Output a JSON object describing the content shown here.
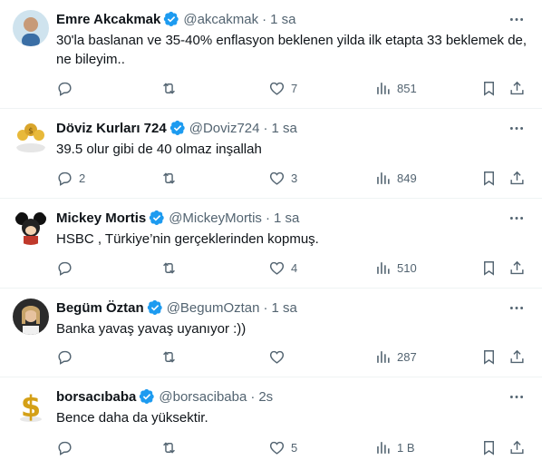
{
  "tweets": [
    {
      "name": "Emre Akcakmak",
      "handle": "@akcakmak",
      "dot": "·",
      "time": "1 sa",
      "text": "30'la baslanan ve 35-40% enflasyon beklenen yilda ilk etapta 33 beklemek de, ne bileyim..",
      "replies": "",
      "retweets": "",
      "likes": "7",
      "views": "851",
      "avatar_icon": "person-photo"
    },
    {
      "name": "Döviz Kurları 724",
      "handle": "@Doviz724",
      "dot": "·",
      "time": "1 sa",
      "text": "39.5 olur gibi de 40 olmaz inşallah",
      "replies": "2",
      "retweets": "",
      "likes": "3",
      "views": "849",
      "avatar_icon": "dollar-coins-logo"
    },
    {
      "name": "Mickey Mortis",
      "handle": "@MickeyMortis",
      "dot": "·",
      "time": "1 sa",
      "text": "HSBC , Türkiye’nin gerçeklerinden kopmuş.",
      "replies": "",
      "retweets": "",
      "likes": "4",
      "views": "510",
      "avatar_icon": "cartoon-mouse"
    },
    {
      "name": "Begüm Öztan",
      "handle": "@BegumOztan",
      "dot": "·",
      "time": "1 sa",
      "text": "Banka yavaş yavaş uyanıyor :))",
      "replies": "",
      "retweets": "",
      "likes": "",
      "views": "287",
      "avatar_icon": "person-photo"
    },
    {
      "name": "borsacıbaba",
      "handle": "@borsacibaba",
      "dot": "·",
      "time": "2s",
      "text": "Bence daha da yüksektir.",
      "replies": "",
      "retweets": "",
      "likes": "5",
      "views": "1 B",
      "avatar_icon": "dollar-sign"
    }
  ],
  "colors": {
    "verified": "#1d9bf0",
    "text": "#0f1419",
    "secondary": "#536471",
    "divider": "#eff3f4"
  }
}
